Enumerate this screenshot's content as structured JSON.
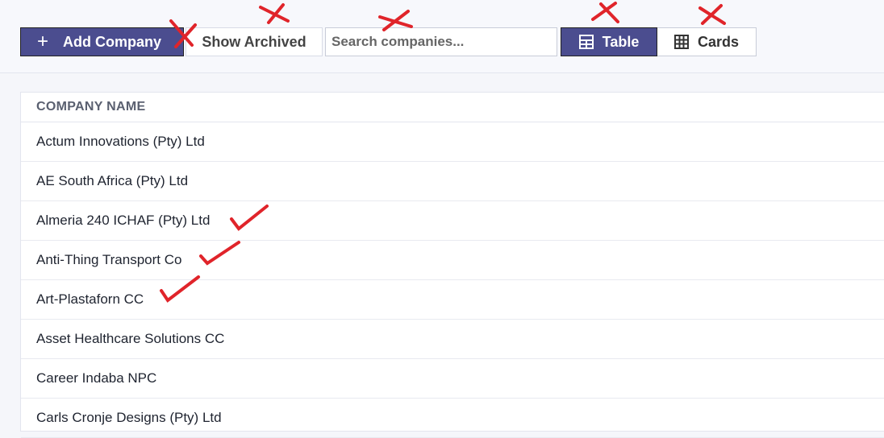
{
  "toolbar": {
    "add_label": "Add Company",
    "archived_label": "Show Archived",
    "search_placeholder": "Search companies...",
    "view_table_label": "Table",
    "view_cards_label": "Cards",
    "active_view": "Table"
  },
  "table": {
    "header": "COMPANY NAME",
    "rows": [
      "Actum Innovations (Pty) Ltd",
      "AE South Africa (Pty) Ltd",
      "Almeria 240 ICHAF (Pty) Ltd",
      "Anti-Thing Transport Co",
      "Art-Plastaforn CC",
      "Asset Healthcare Solutions CC",
      "Career Indaba NPC",
      "Carls Cronje Designs (Pty) Ltd"
    ]
  },
  "annotations": {
    "crossed": [
      "Add Company",
      "Show Archived",
      "Search companies...",
      "Table",
      "Cards"
    ],
    "checked": [
      "Almeria 240 ICHAF (Pty) Ltd",
      "Anti-Thing Transport Co",
      "Art-Plastaforn CC"
    ],
    "mark_color": "#e0242a"
  },
  "colors": {
    "accent": "#4b4d8f",
    "background": "#f5f6fa"
  }
}
